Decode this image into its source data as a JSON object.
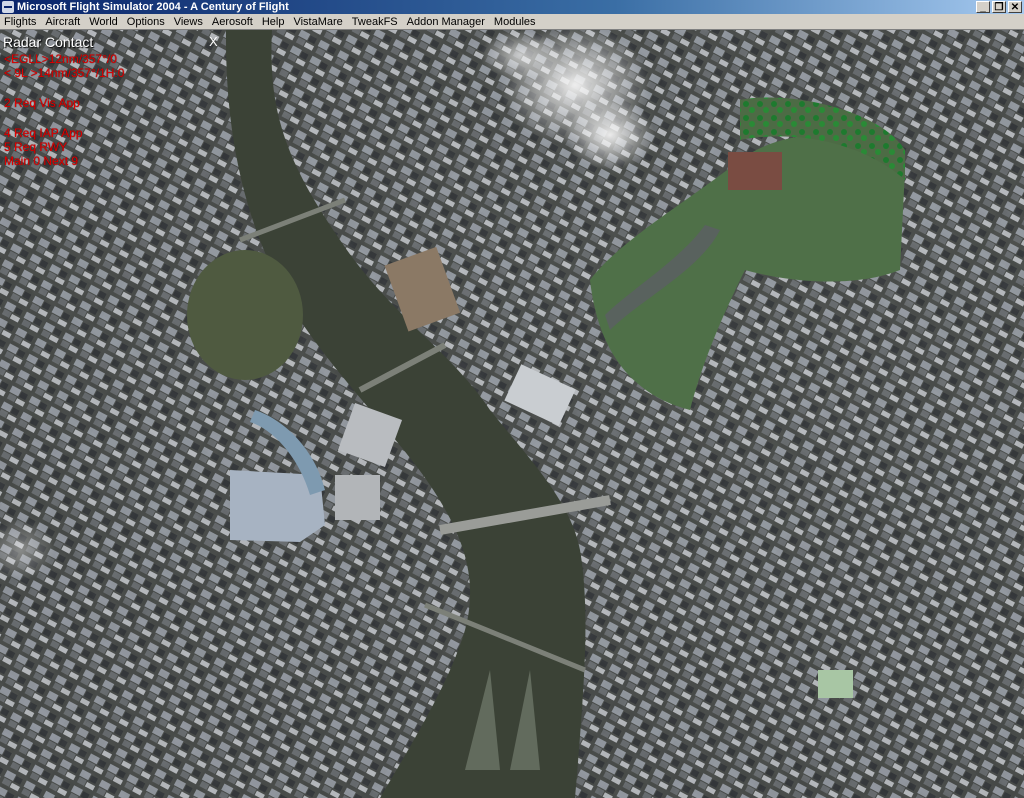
{
  "window": {
    "title": "Microsoft Flight Simulator 2004 - A Century of Flight",
    "buttons": {
      "minimize": "_",
      "maximize": "❐",
      "close": "✕"
    }
  },
  "menu": {
    "items": [
      "Flights",
      "Aircraft",
      "World",
      "Options",
      "Views",
      "Aerosoft",
      "Help",
      "VistaMare",
      "TweakFS",
      "Addon Manager",
      "Modules"
    ]
  },
  "radar": {
    "title": "Radar Contact",
    "close": "X",
    "lines": [
      "<EGLL>12nm/357°/0",
      "< 9L >14nm/357°/1H:0",
      "2 Req Vis App",
      "4 Req IAP App",
      "5 Req RWY",
      "Main 0 Next 9"
    ],
    "colors": {
      "title": "#ffffff",
      "text": "#e00000"
    }
  },
  "scene": {
    "description_icon": "aerial-city-scenery",
    "river_color": "#3b4236",
    "park_color": "#4f7048"
  }
}
